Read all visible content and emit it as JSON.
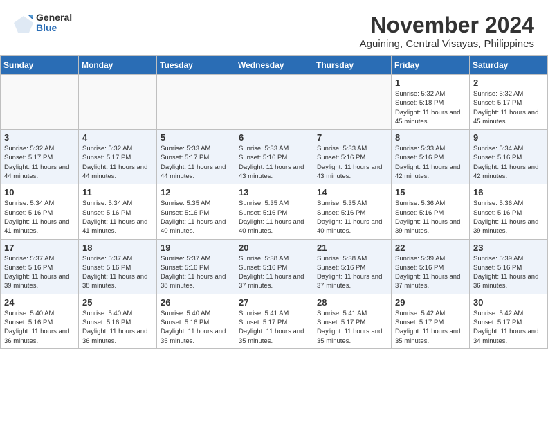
{
  "logo": {
    "general": "General",
    "blue": "Blue"
  },
  "title": "November 2024",
  "location": "Aguining, Central Visayas, Philippines",
  "weekdays": [
    "Sunday",
    "Monday",
    "Tuesday",
    "Wednesday",
    "Thursday",
    "Friday",
    "Saturday"
  ],
  "weeks": [
    [
      {
        "day": "",
        "info": ""
      },
      {
        "day": "",
        "info": ""
      },
      {
        "day": "",
        "info": ""
      },
      {
        "day": "",
        "info": ""
      },
      {
        "day": "",
        "info": ""
      },
      {
        "day": "1",
        "info": "Sunrise: 5:32 AM\nSunset: 5:18 PM\nDaylight: 11 hours and 45 minutes."
      },
      {
        "day": "2",
        "info": "Sunrise: 5:32 AM\nSunset: 5:17 PM\nDaylight: 11 hours and 45 minutes."
      }
    ],
    [
      {
        "day": "3",
        "info": "Sunrise: 5:32 AM\nSunset: 5:17 PM\nDaylight: 11 hours and 44 minutes."
      },
      {
        "day": "4",
        "info": "Sunrise: 5:32 AM\nSunset: 5:17 PM\nDaylight: 11 hours and 44 minutes."
      },
      {
        "day": "5",
        "info": "Sunrise: 5:33 AM\nSunset: 5:17 PM\nDaylight: 11 hours and 44 minutes."
      },
      {
        "day": "6",
        "info": "Sunrise: 5:33 AM\nSunset: 5:16 PM\nDaylight: 11 hours and 43 minutes."
      },
      {
        "day": "7",
        "info": "Sunrise: 5:33 AM\nSunset: 5:16 PM\nDaylight: 11 hours and 43 minutes."
      },
      {
        "day": "8",
        "info": "Sunrise: 5:33 AM\nSunset: 5:16 PM\nDaylight: 11 hours and 42 minutes."
      },
      {
        "day": "9",
        "info": "Sunrise: 5:34 AM\nSunset: 5:16 PM\nDaylight: 11 hours and 42 minutes."
      }
    ],
    [
      {
        "day": "10",
        "info": "Sunrise: 5:34 AM\nSunset: 5:16 PM\nDaylight: 11 hours and 41 minutes."
      },
      {
        "day": "11",
        "info": "Sunrise: 5:34 AM\nSunset: 5:16 PM\nDaylight: 11 hours and 41 minutes."
      },
      {
        "day": "12",
        "info": "Sunrise: 5:35 AM\nSunset: 5:16 PM\nDaylight: 11 hours and 40 minutes."
      },
      {
        "day": "13",
        "info": "Sunrise: 5:35 AM\nSunset: 5:16 PM\nDaylight: 11 hours and 40 minutes."
      },
      {
        "day": "14",
        "info": "Sunrise: 5:35 AM\nSunset: 5:16 PM\nDaylight: 11 hours and 40 minutes."
      },
      {
        "day": "15",
        "info": "Sunrise: 5:36 AM\nSunset: 5:16 PM\nDaylight: 11 hours and 39 minutes."
      },
      {
        "day": "16",
        "info": "Sunrise: 5:36 AM\nSunset: 5:16 PM\nDaylight: 11 hours and 39 minutes."
      }
    ],
    [
      {
        "day": "17",
        "info": "Sunrise: 5:37 AM\nSunset: 5:16 PM\nDaylight: 11 hours and 39 minutes."
      },
      {
        "day": "18",
        "info": "Sunrise: 5:37 AM\nSunset: 5:16 PM\nDaylight: 11 hours and 38 minutes."
      },
      {
        "day": "19",
        "info": "Sunrise: 5:37 AM\nSunset: 5:16 PM\nDaylight: 11 hours and 38 minutes."
      },
      {
        "day": "20",
        "info": "Sunrise: 5:38 AM\nSunset: 5:16 PM\nDaylight: 11 hours and 37 minutes."
      },
      {
        "day": "21",
        "info": "Sunrise: 5:38 AM\nSunset: 5:16 PM\nDaylight: 11 hours and 37 minutes."
      },
      {
        "day": "22",
        "info": "Sunrise: 5:39 AM\nSunset: 5:16 PM\nDaylight: 11 hours and 37 minutes."
      },
      {
        "day": "23",
        "info": "Sunrise: 5:39 AM\nSunset: 5:16 PM\nDaylight: 11 hours and 36 minutes."
      }
    ],
    [
      {
        "day": "24",
        "info": "Sunrise: 5:40 AM\nSunset: 5:16 PM\nDaylight: 11 hours and 36 minutes."
      },
      {
        "day": "25",
        "info": "Sunrise: 5:40 AM\nSunset: 5:16 PM\nDaylight: 11 hours and 36 minutes."
      },
      {
        "day": "26",
        "info": "Sunrise: 5:40 AM\nSunset: 5:16 PM\nDaylight: 11 hours and 35 minutes."
      },
      {
        "day": "27",
        "info": "Sunrise: 5:41 AM\nSunset: 5:17 PM\nDaylight: 11 hours and 35 minutes."
      },
      {
        "day": "28",
        "info": "Sunrise: 5:41 AM\nSunset: 5:17 PM\nDaylight: 11 hours and 35 minutes."
      },
      {
        "day": "29",
        "info": "Sunrise: 5:42 AM\nSunset: 5:17 PM\nDaylight: 11 hours and 35 minutes."
      },
      {
        "day": "30",
        "info": "Sunrise: 5:42 AM\nSunset: 5:17 PM\nDaylight: 11 hours and 34 minutes."
      }
    ]
  ]
}
